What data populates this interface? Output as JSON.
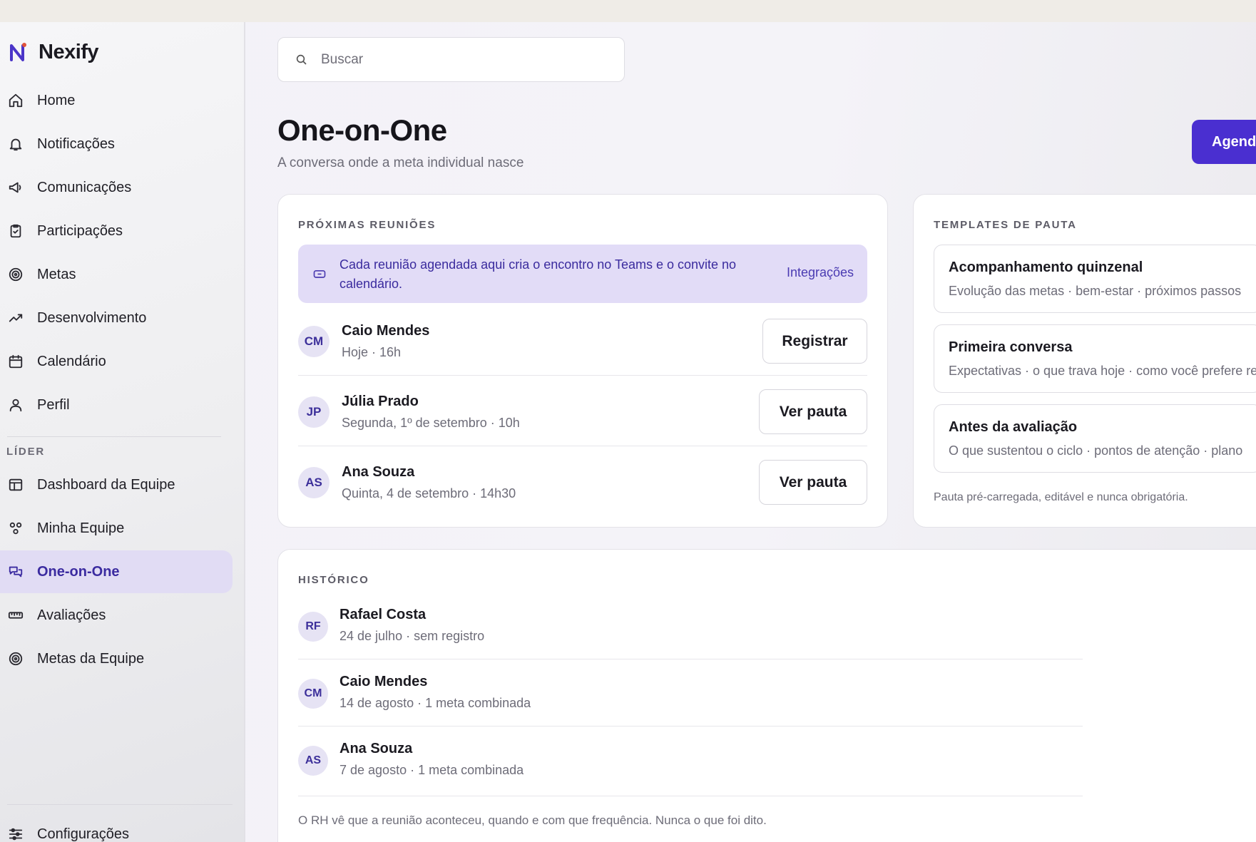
{
  "brand": {
    "name": "Nexify"
  },
  "sidebar": {
    "items": [
      {
        "label": "Home",
        "icon": "home-icon"
      },
      {
        "label": "Notificações",
        "icon": "bell-icon"
      },
      {
        "label": "Comunicações",
        "icon": "megaphone-icon"
      },
      {
        "label": "Participações",
        "icon": "clipboard-check-icon"
      },
      {
        "label": "Metas",
        "icon": "target-icon"
      },
      {
        "label": "Desenvolvimento",
        "icon": "trend-up-icon"
      },
      {
        "label": "Calendário",
        "icon": "calendar-icon"
      },
      {
        "label": "Perfil",
        "icon": "user-icon"
      }
    ],
    "leader_section_label": "LÍDER",
    "leader_items": [
      {
        "label": "Dashboard da Equipe",
        "icon": "layout-icon"
      },
      {
        "label": "Minha Equipe",
        "icon": "team-icon"
      },
      {
        "label": "One-on-One",
        "icon": "chat-icon",
        "active": true
      },
      {
        "label": "Avaliações",
        "icon": "ruler-icon"
      },
      {
        "label": "Metas da Equipe",
        "icon": "target-icon"
      }
    ],
    "settings_label": "Configurações"
  },
  "search": {
    "placeholder": "Buscar"
  },
  "page": {
    "title": "One-on-One",
    "subtitle": "A conversa onde a meta individual nasce",
    "cta_label": "Agend"
  },
  "upcoming": {
    "label": "PRÓXIMAS REUNIÕES",
    "banner_text": "Cada reunião agendada aqui cria o encontro no Teams e o convite no calendário.",
    "banner_link": "Integrações",
    "meetings": [
      {
        "initials": "CM",
        "name": "Caio Mendes",
        "when": "Hoje · 16h",
        "action": "Registrar"
      },
      {
        "initials": "JP",
        "name": "Júlia Prado",
        "when": "Segunda, 1º de setembro · 10h",
        "action": "Ver pauta"
      },
      {
        "initials": "AS",
        "name": "Ana Souza",
        "when": "Quinta, 4 de setembro · 14h30",
        "action": "Ver pauta"
      }
    ]
  },
  "templates": {
    "label": "TEMPLATES DE PAUTA",
    "items": [
      {
        "name": "Acompanhamento quinzenal",
        "desc": "Evolução das metas · bem-estar · próximos passos"
      },
      {
        "name": "Primeira conversa",
        "desc": "Expectativas · o que trava hoje · como você prefere rec"
      },
      {
        "name": "Antes da avaliação",
        "desc": "O que sustentou o ciclo · pontos de atenção · plano"
      }
    ],
    "footnote": "Pauta pré-carregada, editável e nunca obrigatória."
  },
  "history": {
    "label": "HISTÓRICO",
    "items": [
      {
        "initials": "RF",
        "name": "Rafael Costa",
        "detail": "24 de julho · sem registro"
      },
      {
        "initials": "CM",
        "name": "Caio Mendes",
        "detail": "14 de agosto · 1 meta combinada"
      },
      {
        "initials": "AS",
        "name": "Ana Souza",
        "detail": "7 de agosto · 1 meta combinada"
      }
    ],
    "footnote": "O RH vê que a reunião aconteceu, quando e com que frequência. Nunca o que foi dito."
  },
  "colors": {
    "accent": "#4a2fd0",
    "active_bg": "#e1dcf4",
    "banner_bg": "#e2dcf7"
  }
}
